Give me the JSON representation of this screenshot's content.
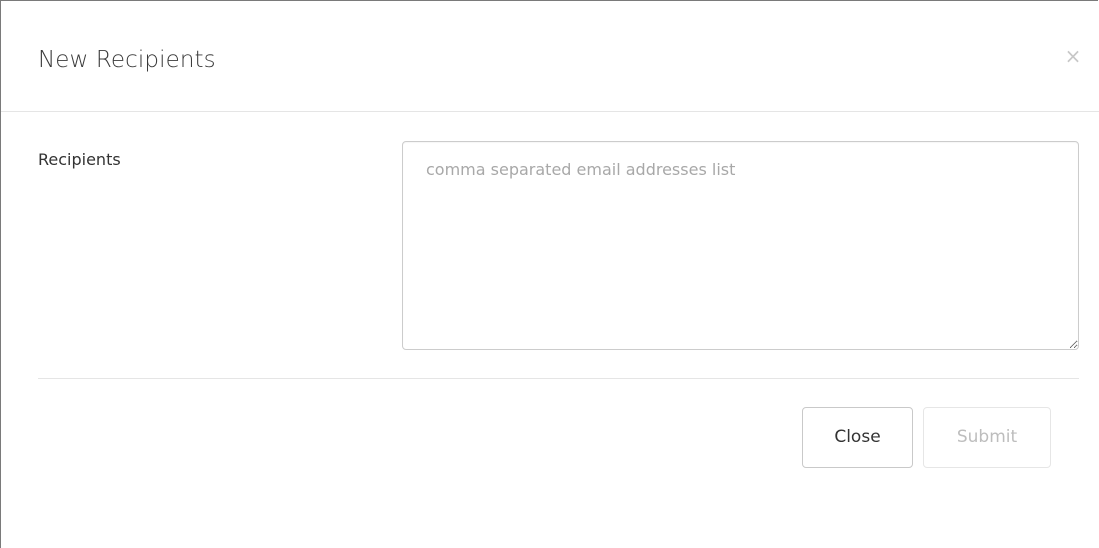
{
  "modal": {
    "title": "New Recipients",
    "close_glyph": "×"
  },
  "form": {
    "recipients_label": "Recipients",
    "recipients_placeholder": "comma separated email addresses list",
    "recipients_value": ""
  },
  "footer": {
    "close_label": "Close",
    "submit_label": "Submit",
    "submit_disabled": true
  }
}
